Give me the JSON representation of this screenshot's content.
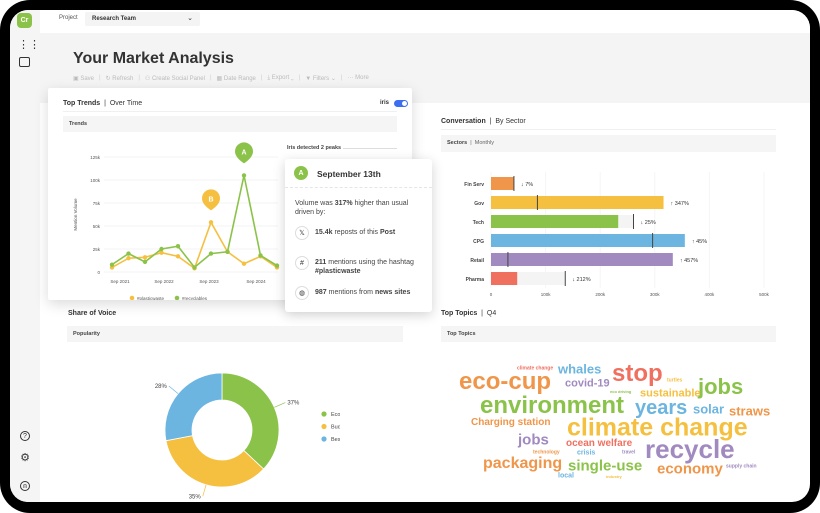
{
  "app": {
    "logo_text": "Cr"
  },
  "topbar": {
    "project_label": "Project",
    "project_value": "Research Team"
  },
  "sidebar": {
    "icons": [
      "apps-grid-icon",
      "panel-layout-icon",
      "help-icon",
      "settings-gear-icon",
      "user-account-icon"
    ]
  },
  "header": {
    "title": "Your Market Analysis",
    "toolbar": [
      {
        "label": "Save",
        "icon": "save-icon"
      },
      {
        "label": "Refresh",
        "icon": "refresh-icon"
      },
      {
        "label": "Create Social Panel",
        "icon": "people-icon"
      },
      {
        "label": "Date Range",
        "icon": "calendar-icon"
      },
      {
        "label": "Export",
        "icon": "download-icon",
        "dropdown": true
      },
      {
        "label": "Filters",
        "icon": "filter-icon",
        "dropdown": true
      },
      {
        "label": "More",
        "icon": "more-dots-icon"
      }
    ]
  },
  "trends": {
    "title": "Top Trends",
    "subtitle": "Over Time",
    "iris_label": "iris",
    "iris_on": true,
    "band": "Trends",
    "peaks_text": "Iris detected 2 peaks"
  },
  "tooltip": {
    "badge": "A",
    "date": "September 13th",
    "summary_pre": "Volume was ",
    "summary_bold": "317%",
    "summary_post": " higher than usual driven by:",
    "rows": [
      {
        "icon": "x-logo-icon",
        "glyph": "𝕏",
        "bold": "15.4k",
        "text": " reposts of this ",
        "bold2": "Post"
      },
      {
        "icon": "hashtag-icon",
        "glyph": "#",
        "bold": "211",
        "text": " mentions using the hashtag ",
        "bold2": "#plasticwaste"
      },
      {
        "icon": "globe-icon",
        "glyph": "◍",
        "bold": "987",
        "text": " mentions from ",
        "bold2": "news sites"
      }
    ]
  },
  "sov": {
    "title": "Share of Voice",
    "band": "Popularity"
  },
  "conversation": {
    "title": "Conversation",
    "subtitle": "By Sector",
    "band": "Sectors",
    "band_sub": "Monthly"
  },
  "topics": {
    "title": "Top Topics",
    "subtitle": "Q4",
    "band": "Top Topics",
    "words": [
      {
        "text": "climate change",
        "color": "#f07060"
      },
      {
        "text": "whales",
        "color": "#6bb5e0"
      },
      {
        "text": "stop",
        "color": "#f07060"
      },
      {
        "text": "turtles",
        "color": "#f5c040"
      },
      {
        "text": "jobs",
        "color": "#8bc34a"
      },
      {
        "text": "eco-cup",
        "color": "#f0964a"
      },
      {
        "text": "covid-19",
        "color": "#a08ac0"
      },
      {
        "text": "eco driving",
        "color": "#8bc34a"
      },
      {
        "text": "sustainable",
        "color": "#f5c040"
      },
      {
        "text": "environment",
        "color": "#8bc34a"
      },
      {
        "text": "years",
        "color": "#6bb5e0"
      },
      {
        "text": "solar",
        "color": "#6bb5e0"
      },
      {
        "text": "straws",
        "color": "#f0964a"
      },
      {
        "text": "Charging station",
        "color": "#f0964a"
      },
      {
        "text": "climate change",
        "color": "#f5c040"
      },
      {
        "text": "jobs",
        "color": "#a08ac0"
      },
      {
        "text": "ocean welfare",
        "color": "#f07060"
      },
      {
        "text": "recycle",
        "color": "#a08ac0"
      },
      {
        "text": "technology",
        "color": "#f0964a"
      },
      {
        "text": "crisis",
        "color": "#6bb5e0"
      },
      {
        "text": "travel",
        "color": "#a08ac0"
      },
      {
        "text": "packaging",
        "color": "#f0964a"
      },
      {
        "text": "single-use",
        "color": "#8bc34a"
      },
      {
        "text": "economy",
        "color": "#f0964a"
      },
      {
        "text": "supply chain",
        "color": "#a08ac0"
      },
      {
        "text": "local",
        "color": "#6bb5e0"
      },
      {
        "text": "industry",
        "color": "#f5c040"
      }
    ]
  },
  "chart_data": [
    {
      "type": "line",
      "ylabel": "Mention Volume",
      "ylim": [
        0,
        125000
      ],
      "yticks": [
        "0",
        "25k",
        "50k",
        "75k",
        "100k",
        "125k"
      ],
      "xticks": [
        "Sep 2021",
        "Sep 2022",
        "Sep 2023",
        "Sep 2024"
      ],
      "series": [
        {
          "name": "#plasticwaste",
          "color": "#f5c040",
          "values": [
            5000,
            15000,
            16000,
            21000,
            17000,
            4000,
            54000,
            22000,
            9000,
            17000,
            5000
          ],
          "peak": {
            "label": "B",
            "index": 6
          }
        },
        {
          "name": "#recyclables",
          "color": "#8bc34a",
          "values": [
            8000,
            20000,
            11000,
            25000,
            28000,
            5000,
            20000,
            22000,
            105000,
            18000,
            7000
          ],
          "peak": {
            "label": "A",
            "index": 8
          }
        }
      ]
    },
    {
      "type": "bar",
      "orientation": "horizontal",
      "xlim": [
        0,
        500000
      ],
      "xticks": [
        "0",
        "100k",
        "200k",
        "300k",
        "400k",
        "500k"
      ],
      "categories": [
        "Fin Serv",
        "Gov",
        "Tech",
        "CPG",
        "Retail",
        "Pharma"
      ],
      "values": [
        42000,
        316000,
        233000,
        355000,
        333000,
        48000
      ],
      "previous": [
        42000,
        85000,
        261000,
        296000,
        31000,
        136000
      ],
      "changes": [
        {
          "dir": "down",
          "label": "7%"
        },
        {
          "dir": "up",
          "label": "347%"
        },
        {
          "dir": "down",
          "label": "25%"
        },
        {
          "dir": "up",
          "label": "45%"
        },
        {
          "dir": "up",
          "label": "457%"
        },
        {
          "dir": "down",
          "label": "212%"
        }
      ],
      "colors": [
        "#f0964a",
        "#f5c040",
        "#8bc34a",
        "#6bb5e0",
        "#a08ac0",
        "#f07060"
      ]
    },
    {
      "type": "pie",
      "donut": true,
      "categories": [
        "Eco Range",
        "Budget Range",
        "Best Of Range"
      ],
      "values": [
        37,
        35,
        28
      ],
      "labels": [
        "37%",
        "35%",
        "28%"
      ],
      "colors": [
        "#8bc34a",
        "#f5c040",
        "#6bb5e0"
      ],
      "legend": "right"
    }
  ]
}
